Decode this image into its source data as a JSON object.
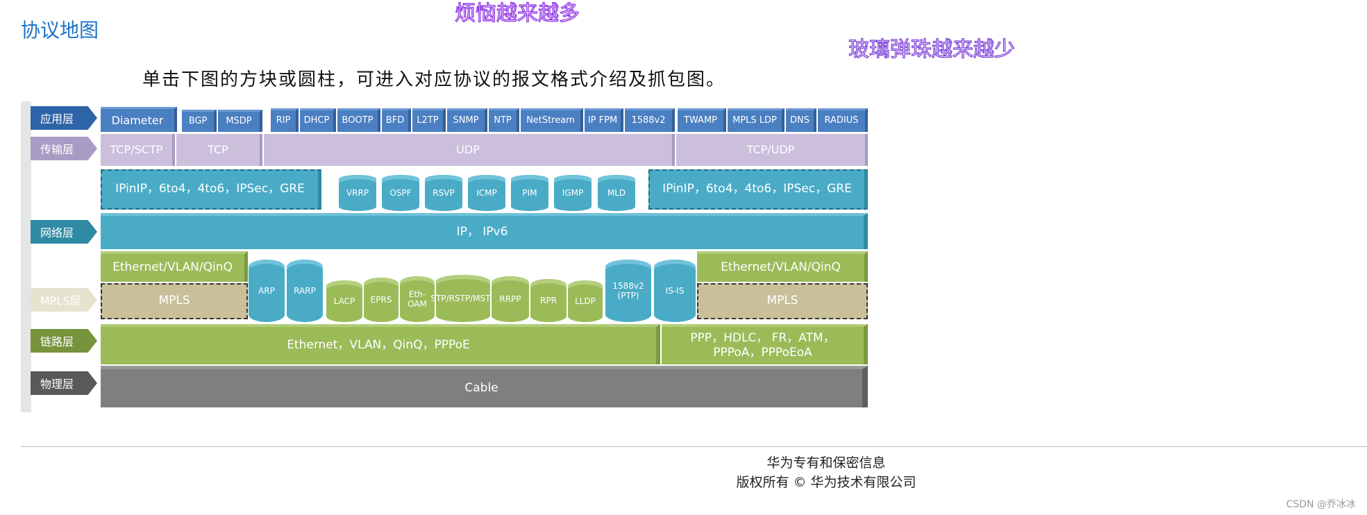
{
  "page": {
    "title": "协议地图",
    "deco_text_1": "烦恼越来越多",
    "deco_text_2": "玻璃弹珠越来越少",
    "instruction": "单击下图的方块或圆柱，可进入对应协议的报文格式介绍及抓包图。",
    "footer_line1": "华为专有和保密信息",
    "footer_line2": "版权所有 © 华为技术有限公司",
    "watermark": "CSDN @乔冰冰"
  },
  "layers": {
    "app": "应用层",
    "transport": "传输层",
    "network": "网络层",
    "mpls": "MPLS层",
    "link": "链路层",
    "physical": "物理层"
  },
  "layer_colors": {
    "app": "#2e64a8",
    "transport": "#a99cc4",
    "network": "#2f8aa3",
    "mpls": "#e6e3cf",
    "link": "#77933c",
    "physical": "#595959"
  },
  "app_protocols": [
    "Diameter",
    "BGP",
    "MSDP",
    "RIP",
    "DHCP",
    "BOOTP",
    "BFD",
    "L2TP",
    "SNMP",
    "NTP",
    "NetStream",
    "IP FPM",
    "1588v2",
    "TWAMP",
    "MPLS LDP",
    "DNS",
    "RADIUS"
  ],
  "transport_protocols": [
    "TCP/SCTP",
    "TCP",
    "UDP",
    "TCP/UDP"
  ],
  "network": {
    "tunnel_left": "IPinIP，6to4，4to6，IPSec，GRE",
    "tunnel_right": "IPinIP，6to4，4to6，IPSec，GRE",
    "cylinders": [
      "VRRP",
      "OSPF",
      "RSVP",
      "ICMP",
      "PIM",
      "IGMP",
      "MLD"
    ],
    "ip": "IP，   IPv6"
  },
  "link_upper": {
    "eth_left": "Ethernet/VLAN/QinQ",
    "eth_right": "Ethernet/VLAN/QinQ",
    "mpls_left": "MPLS",
    "mpls_right": "MPLS",
    "cylinders": [
      "ARP",
      "RARP",
      "LACP",
      "EPRS",
      "Eth-OAM",
      "STP/RSTP/MSTP",
      "RRPP",
      "RPR",
      "LLDP",
      "1588v2 (PTP)",
      "IS-IS"
    ]
  },
  "link": {
    "ethernet": "Ethernet，VLAN，QinQ，PPPoE",
    "ppp": "PPP，HDLC， FR，ATM，PPPoA，PPPoEoA"
  },
  "physical": {
    "cable": "Cable"
  }
}
